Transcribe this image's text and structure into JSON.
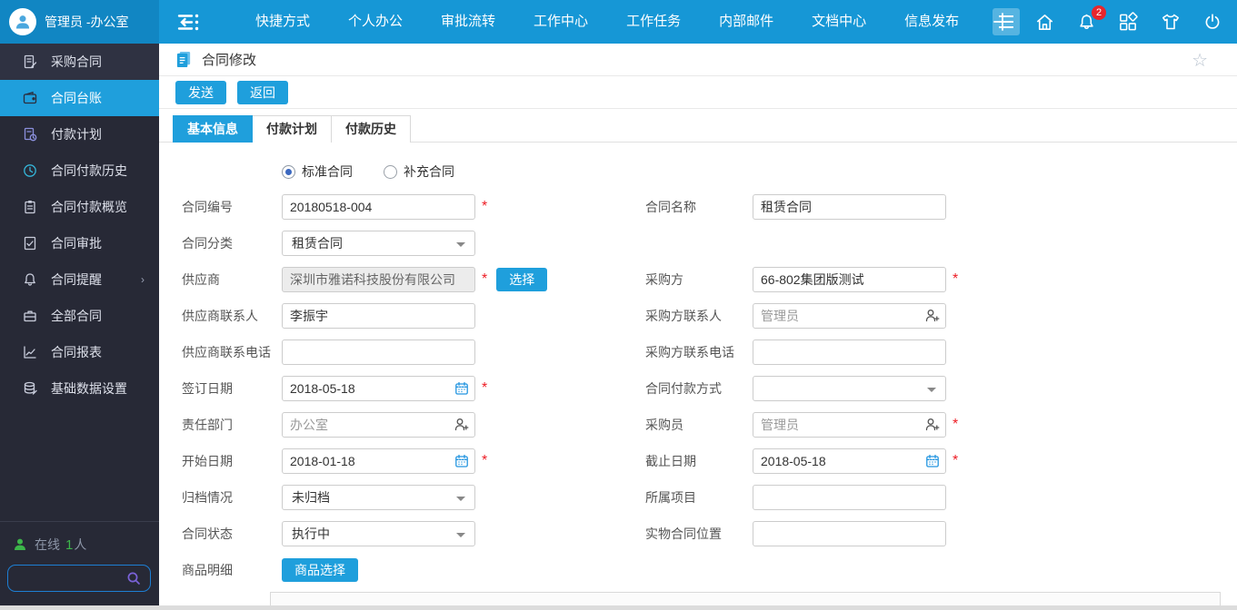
{
  "topbar": {
    "user": "管理员 -办公室",
    "menu": [
      "快捷方式",
      "个人办公",
      "审批流转",
      "工作中心",
      "工作任务",
      "内部邮件",
      "文档中心",
      "信息发布"
    ],
    "badge_count": "2"
  },
  "sidebar": {
    "items": [
      {
        "label": "采购合同"
      },
      {
        "label": "合同台账",
        "active": true
      },
      {
        "label": "付款计划"
      },
      {
        "label": "合同付款历史"
      },
      {
        "label": "合同付款概览"
      },
      {
        "label": "合同审批"
      },
      {
        "label": "合同提醒",
        "has_submenu": true
      },
      {
        "label": "全部合同"
      },
      {
        "label": "合同报表"
      },
      {
        "label": "基础数据设置"
      }
    ],
    "submenu_arrow": "›",
    "online_label": "在线",
    "online_count": "1",
    "online_unit": "人"
  },
  "page": {
    "title": "合同修改",
    "star": "☆"
  },
  "toolbar": {
    "send": "发送",
    "back": "返回"
  },
  "tabs": [
    {
      "label": "基本信息",
      "active": true
    },
    {
      "label": "付款计划",
      "active": false
    },
    {
      "label": "付款历史",
      "active": false
    }
  ],
  "contract_type": {
    "standard": "标准合同",
    "supplement": "补充合同",
    "selected": "标准合同"
  },
  "form": {
    "required_marker": "*",
    "left": [
      {
        "label": "合同编号",
        "value": "20180518-004",
        "required": true
      },
      {
        "label": "合同分类",
        "value": "租赁合同",
        "type": "select"
      },
      {
        "label": "供应商",
        "value": "深圳市雅诺科技股份有限公司",
        "required": true,
        "button": "选择"
      },
      {
        "label": "供应商联系人",
        "value": "李振宇"
      },
      {
        "label": "供应商联系电话",
        "value": ""
      },
      {
        "label": "签订日期",
        "value": "2018-05-18",
        "required": true,
        "type": "date"
      },
      {
        "label": "责任部门",
        "value": "办公室",
        "type": "person"
      },
      {
        "label": "开始日期",
        "value": "2018-01-18",
        "required": true,
        "type": "date"
      },
      {
        "label": "归档情况",
        "value": "未归档",
        "type": "select"
      },
      {
        "label": "合同状态",
        "value": "执行中",
        "type": "select"
      },
      {
        "label": "商品明细",
        "button": "商品选择"
      }
    ],
    "right": [
      {
        "label": "合同名称",
        "value": "租赁合同"
      },
      {
        "label": "采购方",
        "value": "66-802集团版测试",
        "required": true
      },
      {
        "label": "采购方联系人",
        "value": "管理员",
        "type": "person"
      },
      {
        "label": "采购方联系电话",
        "value": ""
      },
      {
        "label": "合同付款方式",
        "value": "",
        "type": "select"
      },
      {
        "label": "采购员",
        "value": "管理员",
        "required": true,
        "type": "person"
      },
      {
        "label": "截止日期",
        "value": "2018-05-18",
        "required": true,
        "type": "date"
      },
      {
        "label": "所属项目",
        "value": ""
      },
      {
        "label": "实物合同位置",
        "value": ""
      }
    ]
  },
  "colors": {
    "topbar_blue": "#1697d6",
    "userblock_blue": "#1186c3",
    "sidebar_dark": "#272936",
    "accent_blue": "#1f9fdc",
    "badge_red": "#e8262d",
    "online_green": "#3cb54a",
    "required_red": "#ed1c24"
  }
}
